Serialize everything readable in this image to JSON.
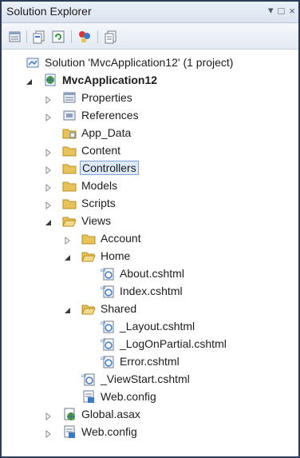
{
  "window": {
    "title": "Solution Explorer",
    "controls": [
      "▾",
      "□",
      "×"
    ]
  },
  "toolbar": {
    "buttons": [
      "properties-icon",
      "show-all-files-icon",
      "refresh-icon",
      "class-diagram-icon",
      "view-code-icon"
    ]
  },
  "tree": [
    {
      "label": "Solution 'MvcApplication12' (1 project)",
      "icon": "solution-icon",
      "expander": "none",
      "bold": false
    },
    {
      "label": "MvcApplication12",
      "icon": "web-project-icon",
      "expander": "expanded",
      "bold": true
    },
    {
      "label": "Properties",
      "icon": "properties-icon",
      "expander": "collapsed",
      "bold": false
    },
    {
      "label": "References",
      "icon": "references-icon",
      "expander": "collapsed",
      "bold": false
    },
    {
      "label": "App_Data",
      "icon": "app-data-folder-icon",
      "expander": "none",
      "bold": false
    },
    {
      "label": "Content",
      "icon": "folder-icon",
      "expander": "collapsed",
      "bold": false
    },
    {
      "label": "Controllers",
      "icon": "folder-icon",
      "expander": "collapsed",
      "bold": false,
      "selected": true
    },
    {
      "label": "Models",
      "icon": "folder-icon",
      "expander": "collapsed",
      "bold": false
    },
    {
      "label": "Scripts",
      "icon": "folder-icon",
      "expander": "collapsed",
      "bold": false
    },
    {
      "label": "Views",
      "icon": "folder-open-icon",
      "expander": "expanded",
      "bold": false
    },
    {
      "label": "Account",
      "icon": "folder-icon",
      "expander": "collapsed",
      "bold": false
    },
    {
      "label": "Home",
      "icon": "folder-open-icon",
      "expander": "expanded",
      "bold": false
    },
    {
      "label": "About.cshtml",
      "icon": "cshtml-file-icon",
      "expander": "none",
      "bold": false
    },
    {
      "label": "Index.cshtml",
      "icon": "cshtml-file-icon",
      "expander": "none",
      "bold": false
    },
    {
      "label": "Shared",
      "icon": "folder-open-icon",
      "expander": "expanded",
      "bold": false
    },
    {
      "label": "_Layout.cshtml",
      "icon": "cshtml-file-icon",
      "expander": "none",
      "bold": false
    },
    {
      "label": "_LogOnPartial.cshtml",
      "icon": "cshtml-file-icon",
      "expander": "none",
      "bold": false
    },
    {
      "label": "Error.cshtml",
      "icon": "cshtml-file-icon",
      "expander": "none",
      "bold": false
    },
    {
      "label": "_ViewStart.cshtml",
      "icon": "cshtml-file-icon",
      "expander": "none",
      "bold": false
    },
    {
      "label": "Web.config",
      "icon": "config-file-icon",
      "expander": "none",
      "bold": false
    },
    {
      "label": "Global.asax",
      "icon": "global-asax-icon",
      "expander": "collapsed",
      "bold": false
    },
    {
      "label": "Web.config",
      "icon": "config-file-icon",
      "expander": "collapsed",
      "bold": false
    }
  ],
  "colors": {
    "selection_bg": "#dde9f7",
    "selection_border": "#7da2ce",
    "folder": "#e8c25a",
    "window_border": "#2b3b58"
  }
}
